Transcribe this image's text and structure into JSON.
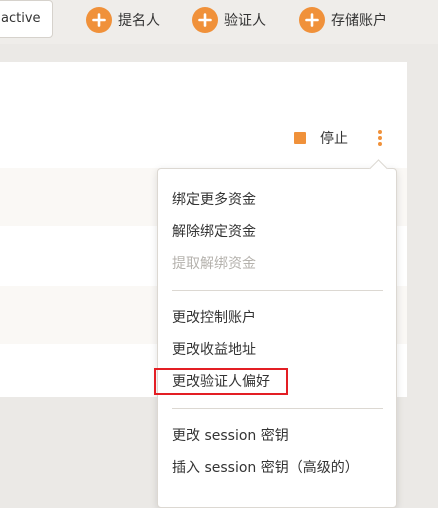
{
  "header": {
    "status_text": "active",
    "buttons": [
      {
        "label": "提名人",
        "icon": "plus-icon"
      },
      {
        "label": "验证人",
        "icon": "plus-icon"
      },
      {
        "label": "存储账户",
        "icon": "plus-icon"
      }
    ]
  },
  "row_actions": {
    "stop_label": "停止",
    "stop_icon": "stop-square-icon",
    "more_icon": "vertical-ellipsis-icon"
  },
  "menu": {
    "groups": [
      [
        {
          "label": "绑定更多资金",
          "disabled": false
        },
        {
          "label": "解除绑定资金",
          "disabled": false
        },
        {
          "label": "提取解绑资金",
          "disabled": true
        }
      ],
      [
        {
          "label": "更改控制账户",
          "disabled": false
        },
        {
          "label": "更改收益地址",
          "disabled": false
        },
        {
          "label": "更改验证人偏好",
          "disabled": false,
          "highlighted": true
        }
      ],
      [
        {
          "label": "更改 session 密钥",
          "disabled": false
        },
        {
          "label": "插入 session 密钥（高级的）",
          "disabled": false
        }
      ]
    ]
  },
  "colors": {
    "accent": "#f0913a",
    "highlight_border": "#e31e24",
    "disabled_text": "#b5b2ad"
  }
}
